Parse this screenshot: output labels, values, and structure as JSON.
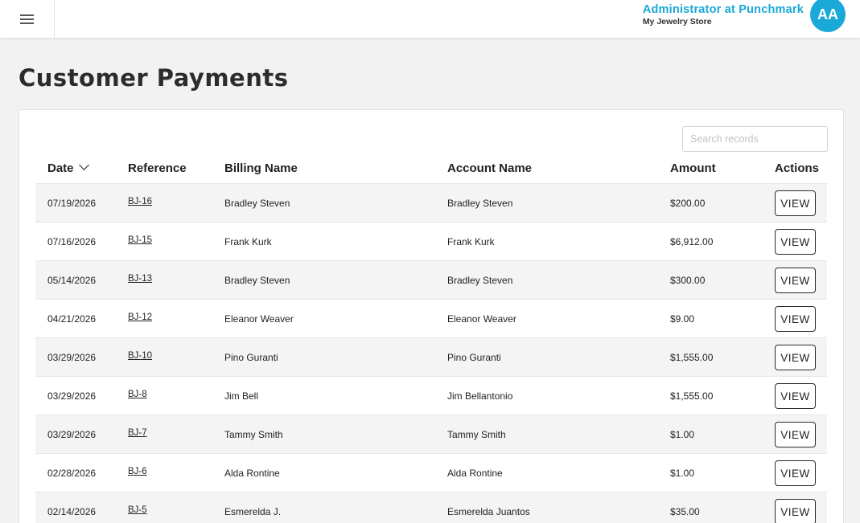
{
  "header": {
    "user_title": "Administrator at Punchmark",
    "store_name": "My Jewelry Store",
    "avatar_initials": "AA",
    "accent_color": "#19a8d8"
  },
  "page": {
    "title": "Customer Payments"
  },
  "search": {
    "placeholder": "Search records",
    "value": ""
  },
  "table": {
    "columns": {
      "date": "Date",
      "reference": "Reference",
      "billing_name": "Billing Name",
      "account_name": "Account Name",
      "amount": "Amount",
      "actions": "Actions"
    },
    "sort": {
      "column": "Date",
      "icon": "chevron-down-icon"
    },
    "rows": [
      {
        "date": "07/19/2026",
        "reference": "BJ-16",
        "billing_name": "Bradley Steven",
        "account_name": "Bradley Steven",
        "amount": "$200.00",
        "action": "VIEW"
      },
      {
        "date": "07/16/2026",
        "reference": "BJ-15",
        "billing_name": "Frank Kurk",
        "account_name": "Frank Kurk",
        "amount": "$6,912.00",
        "action": "VIEW"
      },
      {
        "date": "05/14/2026",
        "reference": "BJ-13",
        "billing_name": "Bradley Steven",
        "account_name": "Bradley Steven",
        "amount": "$300.00",
        "action": "VIEW"
      },
      {
        "date": "04/21/2026",
        "reference": "BJ-12",
        "billing_name": "Eleanor Weaver",
        "account_name": "Eleanor Weaver",
        "amount": "$9.00",
        "action": "VIEW"
      },
      {
        "date": "03/29/2026",
        "reference": "BJ-10",
        "billing_name": "Pino Guranti",
        "account_name": "Pino Guranti",
        "amount": "$1,555.00",
        "action": "VIEW"
      },
      {
        "date": "03/29/2026",
        "reference": "BJ-8",
        "billing_name": "Jim Bell",
        "account_name": "Jim Bellantonio",
        "amount": "$1,555.00",
        "action": "VIEW"
      },
      {
        "date": "03/29/2026",
        "reference": "BJ-7",
        "billing_name": "Tammy Smith",
        "account_name": "Tammy Smith",
        "amount": "$1.00",
        "action": "VIEW"
      },
      {
        "date": "02/28/2026",
        "reference": "BJ-6",
        "billing_name": "Alda Rontine",
        "account_name": "Alda Rontine",
        "amount": "$1.00",
        "action": "VIEW"
      },
      {
        "date": "02/14/2026",
        "reference": "BJ-5",
        "billing_name": "Esmerelda J.",
        "account_name": "Esmerelda Juantos",
        "amount": "$35.00",
        "action": "VIEW"
      }
    ]
  }
}
